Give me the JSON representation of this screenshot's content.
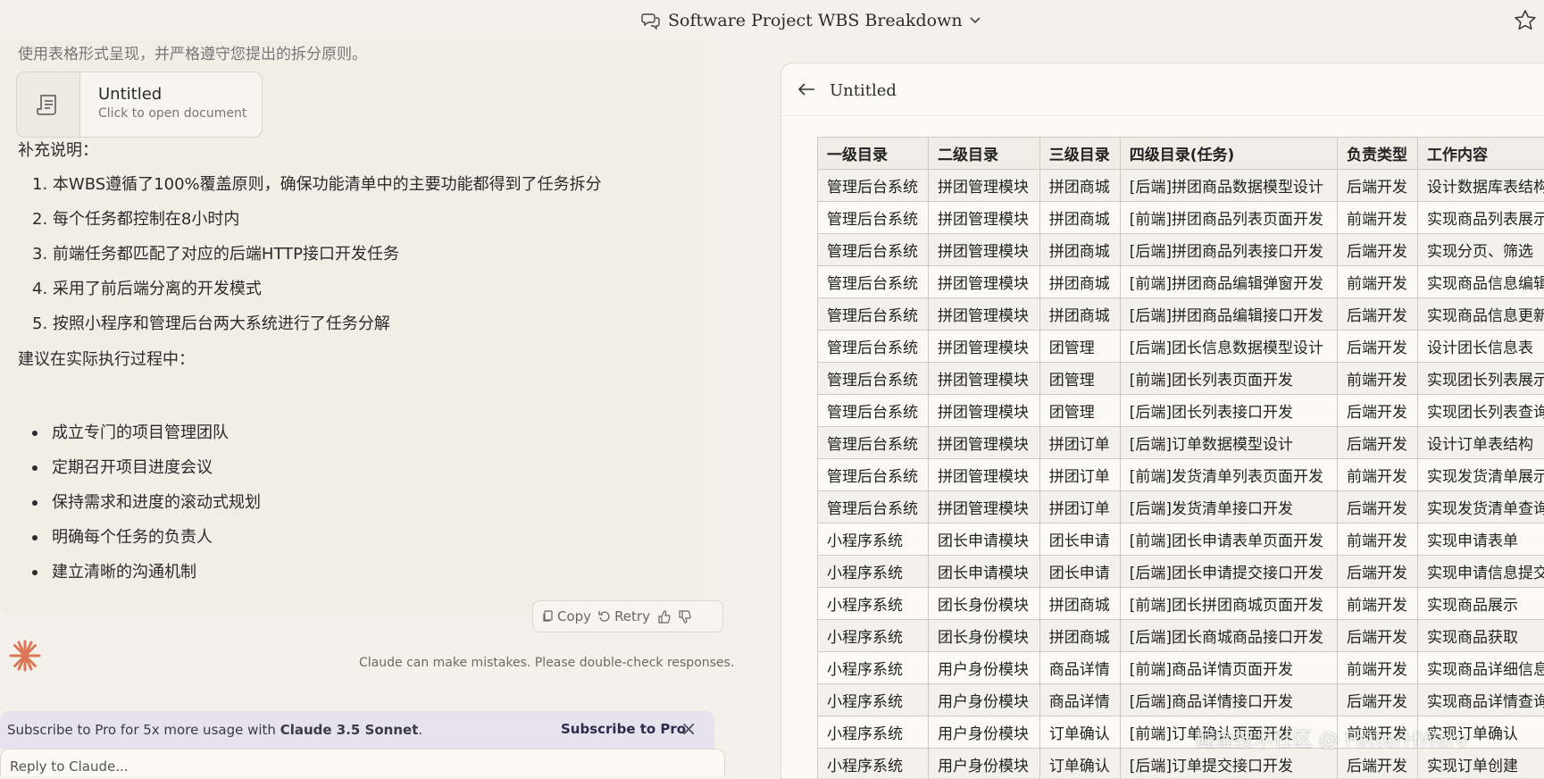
{
  "header": {
    "title": "Software Project WBS Breakdown"
  },
  "message": {
    "cut_line": "使用表格形式呈现，并严格遵守您提出的拆分原则。",
    "doc_card": {
      "title": "Untitled",
      "subtitle": "Click to open document"
    },
    "supplement_heading": "补充说明：",
    "numbered": [
      "本WBS遵循了100%覆盖原则，确保功能清单中的主要功能都得到了任务拆分",
      "每个任务都控制在8小时内",
      "前端任务都匹配了对应的后端HTTP接口开发任务",
      "采用了前后端分离的开发模式",
      "按照小程序和管理后台两大系统进行了任务分解"
    ],
    "suggest_heading": "建议在实际执行过程中：",
    "bullets": [
      "成立专门的项目管理团队",
      "定期召开项目进度会议",
      "保持需求和进度的滚动式规划",
      "明确每个任务的负责人",
      "建立清晰的沟通机制"
    ]
  },
  "actions": {
    "copy": "Copy",
    "retry": "Retry"
  },
  "disclaimer": "Claude can make mistakes. Please double-check responses.",
  "subscribe": {
    "text_prefix": "Subscribe to Pro for 5x more usage with ",
    "model": "Claude 3.5 Sonnet",
    "text_suffix": ".",
    "link": "Subscribe to Pro",
    "close": "×"
  },
  "input": {
    "peek": "Reply to Claude..."
  },
  "panel": {
    "title": "Untitled",
    "columns": [
      "一级目录",
      "二级目录",
      "三级目录",
      "四级目录(任务)",
      "负责类型",
      "工作内容"
    ],
    "rows": [
      [
        "管理后台系统",
        "拼团管理模块",
        "拼团商城",
        "[后端]拼团商品数据模型设计",
        "后端开发",
        "设计数据库表结构"
      ],
      [
        "管理后台系统",
        "拼团管理模块",
        "拼团商城",
        "[前端]拼团商品列表页面开发",
        "前端开发",
        "实现商品列表展示"
      ],
      [
        "管理后台系统",
        "拼团管理模块",
        "拼团商城",
        "[后端]拼团商品列表接口开发",
        "后端开发",
        "实现分页、筛选"
      ],
      [
        "管理后台系统",
        "拼团管理模块",
        "拼团商城",
        "[前端]拼团商品编辑弹窗开发",
        "前端开发",
        "实现商品信息编辑"
      ],
      [
        "管理后台系统",
        "拼团管理模块",
        "拼团商城",
        "[后端]拼团商品编辑接口开发",
        "后端开发",
        "实现商品信息更新"
      ],
      [
        "管理后台系统",
        "拼团管理模块",
        "团管理",
        "[后端]团长信息数据模型设计",
        "后端开发",
        "设计团长信息表"
      ],
      [
        "管理后台系统",
        "拼团管理模块",
        "团管理",
        "[前端]团长列表页面开发",
        "前端开发",
        "实现团长列表展示"
      ],
      [
        "管理后台系统",
        "拼团管理模块",
        "团管理",
        "[后端]团长列表接口开发",
        "后端开发",
        "实现团长列表查询"
      ],
      [
        "管理后台系统",
        "拼团管理模块",
        "拼团订单",
        "[后端]订单数据模型设计",
        "后端开发",
        "设计订单表结构"
      ],
      [
        "管理后台系统",
        "拼团管理模块",
        "拼团订单",
        "[前端]发货清单列表页面开发",
        "前端开发",
        "实现发货清单展示"
      ],
      [
        "管理后台系统",
        "拼团管理模块",
        "拼团订单",
        "[后端]发货清单接口开发",
        "后端开发",
        "实现发货清单查询"
      ],
      [
        "小程序系统",
        "团长申请模块",
        "团长申请",
        "[前端]团长申请表单页面开发",
        "前端开发",
        "实现申请表单"
      ],
      [
        "小程序系统",
        "团长申请模块",
        "团长申请",
        "[后端]团长申请提交接口开发",
        "后端开发",
        "实现申请信息提交"
      ],
      [
        "小程序系统",
        "团长身份模块",
        "拼团商城",
        "[前端]团长拼团商城页面开发",
        "前端开发",
        "实现商品展示"
      ],
      [
        "小程序系统",
        "团长身份模块",
        "拼团商城",
        "[后端]团长商城商品接口开发",
        "后端开发",
        "实现商品获取"
      ],
      [
        "小程序系统",
        "用户身份模块",
        "商品详情",
        "[前端]商品详情页面开发",
        "前端开发",
        "实现商品详细信息"
      ],
      [
        "小程序系统",
        "用户身份模块",
        "商品详情",
        "[后端]商品详情接口开发",
        "后端开发",
        "实现商品详情查询"
      ],
      [
        "小程序系统",
        "用户身份模块",
        "订单确认",
        "[前端]订单确认页面开发",
        "前端开发",
        "实现订单确认"
      ],
      [
        "小程序系统",
        "用户身份模块",
        "订单确认",
        "[后端]订单提交接口开发",
        "后端开发",
        "实现订单创建"
      ]
    ]
  },
  "watermark": "掘金技术社区 @ PatterHWare",
  "colors": {
    "accent": "#d97757",
    "banner": "#e6e3ef"
  }
}
